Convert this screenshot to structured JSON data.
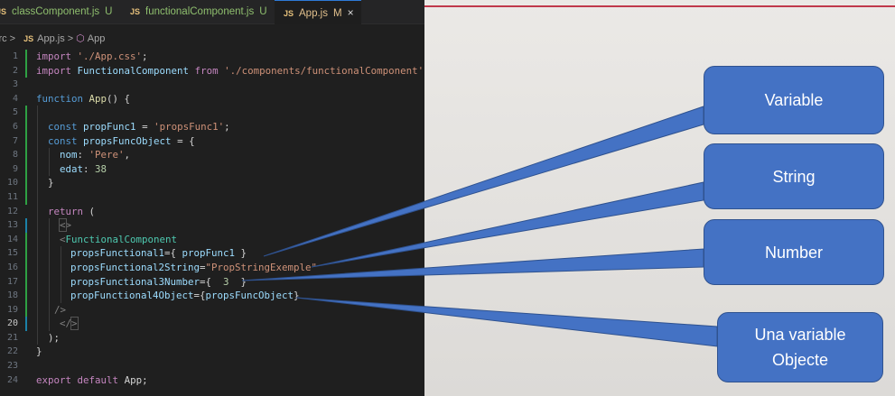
{
  "editor": {
    "tabs": [
      {
        "label": "classComponent.js",
        "status": "U"
      },
      {
        "label": "functionalComponent.js",
        "status": "U"
      },
      {
        "label": "App.js",
        "status": "M",
        "close": "×"
      }
    ],
    "breadcrumb": {
      "folder": "src",
      "file": "App.js",
      "symbol": "App",
      "separator": ">"
    },
    "lines": [
      "1",
      "2",
      "3",
      "4",
      "5",
      "6",
      "7",
      "8",
      "9",
      "10",
      "11",
      "12",
      "13",
      "14",
      "15",
      "16",
      "17",
      "18",
      "19",
      "20",
      "21",
      "22",
      "23",
      "24"
    ],
    "code": {
      "l1_kw": "import",
      "l1_str": "'./App.css'",
      "l2_kw": "import",
      "l2_cls": "FunctionalComponent",
      "l2_from": "from",
      "l2_str": "'./components/functionalComponent'",
      "l4_kw": "function",
      "l4_fn": "App",
      "l6_kw": "const",
      "l6_var": "propFunc1",
      "l6_str": "'propsFunc1'",
      "l7_kw": "const",
      "l7_var": "propsFuncObject",
      "l8_key": "nom",
      "l8_str": "'Pere'",
      "l9_key": "edat",
      "l9_num": "38",
      "l12_kw": "return",
      "l14_cls": "FunctionalComponent",
      "l15_attr": "propsFunctional1",
      "l15_val": "propFunc1",
      "l16_attr": "propsFunctional2String",
      "l16_str": "\"PropStringExemple\"",
      "l17_attr": "propsFunctional3Number",
      "l17_num": "3",
      "l18_attr": "propFunctional4Object",
      "l18_val": "propsFuncObject",
      "l24_kw": "export",
      "l24_kw2": "default",
      "l24_id": "App"
    }
  },
  "callouts": {
    "variable": "Variable",
    "string": "String",
    "number": "Number",
    "object_line1": "Una variable",
    "object_line2": "Objecte"
  },
  "colors": {
    "callout_fill": "#4472c4",
    "accent_line": "#c0394b"
  }
}
